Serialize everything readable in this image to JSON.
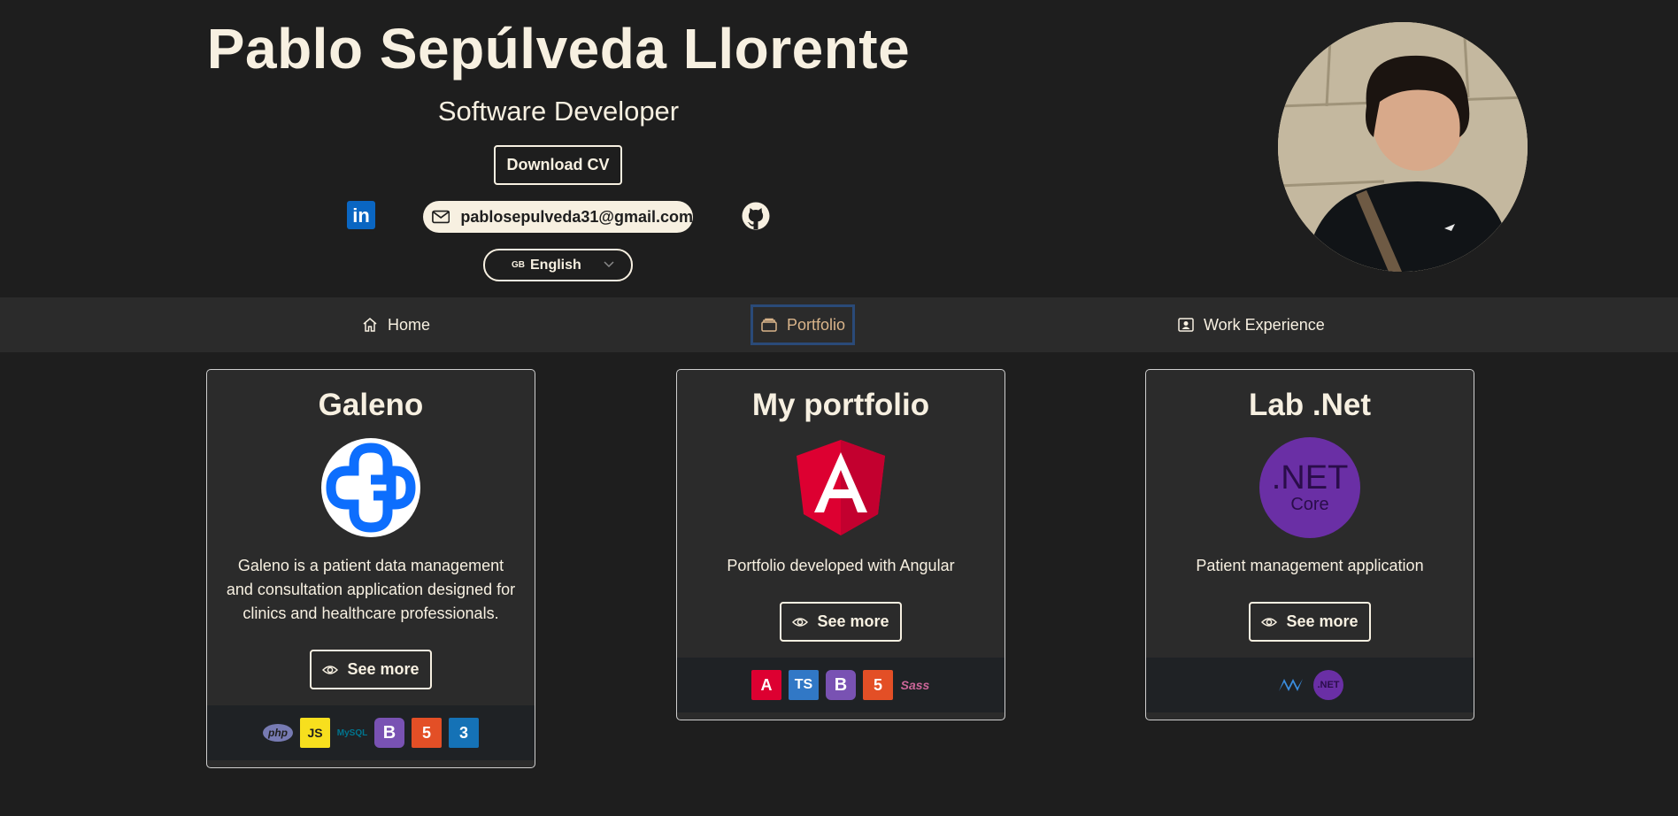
{
  "header": {
    "name": "Pablo Sepúlveda Llorente",
    "role": "Software Developer",
    "download_cv": "Download CV",
    "email": "pablosepulveda31@gmail.com",
    "language": {
      "flag": "GB",
      "selected": "English"
    },
    "linkedin_text": "in"
  },
  "nav": {
    "items": [
      {
        "label": "Home",
        "icon": "home-icon"
      },
      {
        "label": "Portfolio",
        "icon": "briefcase-icon",
        "active": true
      },
      {
        "label": "Work Experience",
        "icon": "person-badge-icon"
      }
    ]
  },
  "projects": [
    {
      "title": "Galeno",
      "description": "Galeno is a patient data management and consultation application designed for clinics and healthcare professionals.",
      "button": "See more",
      "tech": [
        "php",
        "JS",
        "MySQL",
        "B",
        "5",
        "3"
      ]
    },
    {
      "title": "My portfolio",
      "description": "Portfolio developed with Angular",
      "button": "See more",
      "tech": [
        "A",
        "TS",
        "B",
        "5",
        "Sass"
      ]
    },
    {
      "title": "Lab .Net",
      "logo_text": ".NET",
      "logo_sub": "Core",
      "description": "Patient management application",
      "button": "See more",
      "tech": [
        ".NET"
      ]
    }
  ],
  "colors": {
    "background": "#1e1e1e",
    "cream": "#f7f0e1",
    "nav_bg": "#2b2b2b",
    "active_accent": "#d9b48a",
    "active_border": "#2a4a78"
  }
}
